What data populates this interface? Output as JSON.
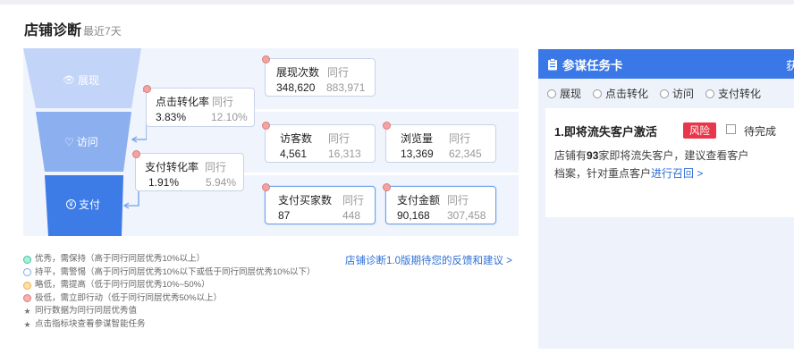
{
  "header": {
    "title": "店铺诊断",
    "subtitle": "最近7天"
  },
  "funnel": {
    "stages": [
      {
        "label": "展现",
        "icon": "eye-icon",
        "glyph": "👁"
      },
      {
        "label": "访问",
        "icon": "heart-icon",
        "glyph": "♡"
      },
      {
        "label": "支付",
        "icon": "yen-icon",
        "glyph": "¥"
      }
    ],
    "colors": [
      "#c2d4f8",
      "#8cb0ef",
      "#3d7be6"
    ]
  },
  "metrics": {
    "click_conversion": {
      "label": "点击转化率",
      "peer_label": "同行",
      "value": "3.83%",
      "peer_value": "12.10%"
    },
    "pay_conversion": {
      "label": "支付转化率",
      "peer_label": "同行",
      "value": "1.91%",
      "peer_value": "5.94%"
    },
    "impressions": {
      "label": "展现次数",
      "peer_label": "同行",
      "value": "348,620",
      "peer_value": "883,971"
    },
    "visitors": {
      "label": "访客数",
      "peer_label": "同行",
      "value": "4,561",
      "peer_value": "16,313"
    },
    "pageviews": {
      "label": "浏览量",
      "peer_label": "同行",
      "value": "13,369",
      "peer_value": "62,345"
    },
    "buyers": {
      "label": "支付买家数",
      "peer_label": "同行",
      "value": "87",
      "peer_value": "448"
    },
    "pay_amount": {
      "label": "支付金额",
      "peer_label": "同行",
      "value": "90,168",
      "peer_value": "307,458"
    }
  },
  "legend": {
    "items": [
      {
        "text": "优秀，需保持（高于同行同层优秀10%以上）",
        "fill": "#a8efdc",
        "stroke": "#38c79a"
      },
      {
        "text": "持平，需警惕（高于同行同层优秀10%以下或低于同行同层优秀10%以下）",
        "fill": "#ffffff",
        "stroke": "#7fa8e8"
      },
      {
        "text": "略低，需提高（低于同行同层优秀10%~50%）",
        "fill": "#fde0a8",
        "stroke": "#f0b04a"
      },
      {
        "text": "极低，需立即行动（低于同行同层优秀50%以上）",
        "fill": "#f6b2b2",
        "stroke": "#e07b7b"
      }
    ],
    "notes": [
      "同行数据为同行同层优秀值",
      "点击指标块查看参谋智能任务"
    ],
    "star": "★"
  },
  "feedback_link": "店铺诊断1.0版期待您的反馈和建议 >",
  "task_panel": {
    "title": "参谋任务卡",
    "title_icon": "clipboard-icon",
    "overflow_text": "获",
    "filters": [
      "展现",
      "点击转化",
      "访问",
      "支付转化"
    ],
    "card": {
      "title": "1.即将流失客户激活",
      "badge": "风险",
      "pending_label": "待完成",
      "desc_prefix": "店铺有",
      "desc_count": "93",
      "desc_mid": "家即将流失客户，建议查看客户档案，针对重点客户",
      "desc_link": "进行召回 >"
    }
  }
}
